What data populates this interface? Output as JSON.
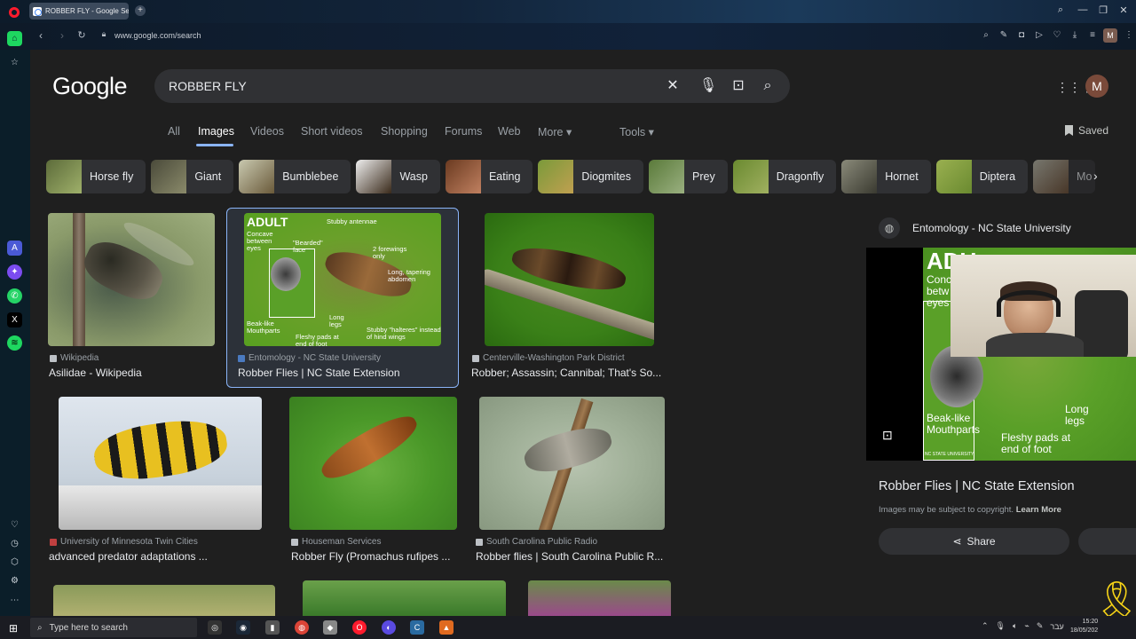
{
  "browser": {
    "tab_title": "ROBBER FLY - Google Search",
    "new_tab": "+",
    "url": "www.google.com/search",
    "profile_initial": "M"
  },
  "google": {
    "logo": "Google",
    "query": "ROBBER FLY",
    "avatar_initial": "M",
    "nav_tabs": [
      "All",
      "Images",
      "Videos",
      "Short videos",
      "Shopping",
      "Forums",
      "Web",
      "More ▾"
    ],
    "tools": "Tools ▾",
    "saved": "Saved"
  },
  "chips": [
    "Horse fly",
    "Giant",
    "Bumblebee",
    "Wasp",
    "Eating",
    "Diogmites",
    "Prey",
    "Dragonfly",
    "Hornet",
    "Diptera",
    "Mo"
  ],
  "results": [
    {
      "source": "Wikipedia",
      "title": "Asilidae - Wikipedia"
    },
    {
      "source": "Entomology - NC State University",
      "title": "Robber Flies | NC State Extension"
    },
    {
      "source": "Centerville-Washington Park District",
      "title": "Robber; Assassin; Cannibal; That's So..."
    },
    {
      "source": "University of Minnesota Twin Cities",
      "title": "advanced predator adaptations ..."
    },
    {
      "source": "Houseman Services",
      "title": "Robber Fly (Promachus rufipes ..."
    },
    {
      "source": "South Carolina Public Radio",
      "title": "Robber flies | South Carolina Public R..."
    }
  ],
  "diagram_labels": {
    "heading": "ADULT",
    "stubby_antennae": "Stubby antennae",
    "concave": "Concave between eyes",
    "bearded": "\"Bearded\" face",
    "forewings": "2 forewings only",
    "abdomen": "Long, tapering abdomen",
    "beak": "Beak-like Mouthparts",
    "legs": "Long legs",
    "pads": "Fleshy pads at end of foot",
    "halteres": "Stubby \"halteres\" instead of hind wings"
  },
  "side_panel": {
    "site": "Entomology - NC State University",
    "title": "Robber Flies | NC State Extension",
    "copyright": "Images may be subject to copyright.",
    "learn_more": "Learn More",
    "share": "Share",
    "image_labels": {
      "heading": "ADU",
      "concave": "Conc betw eyes",
      "beak": "Beak-like Mouthparts",
      "legs": "Long legs",
      "pads": "Fleshy pads at end of foot",
      "credit": "NC STATE UNIVERSITY"
    }
  },
  "taskbar": {
    "search_placeholder": "Type here to search",
    "lang": "עבר",
    "time": "15:20",
    "date": "18/05/202"
  },
  "colors": {
    "accent": "#8ab4f8",
    "page_bg": "#1f1f1f",
    "surface": "#303134",
    "ribbon": "#f7d417"
  }
}
